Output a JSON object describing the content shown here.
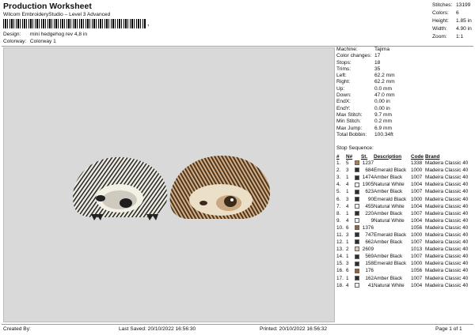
{
  "header": {
    "title": "Production Worksheet",
    "subtitle": "Wilcom EmbroideryStudio – Level 3 Advanced",
    "barcode_suffix": ",",
    "design_label": "Design:",
    "design_value": "mini hedgehog rev 4,8 in",
    "colorway_label": "Colorway:",
    "colorway_value": "Colorway 1"
  },
  "stats": [
    {
      "label": "Stitches:",
      "value": "13199"
    },
    {
      "label": "Colors:",
      "value": "6"
    },
    {
      "label": "Height:",
      "value": "1.85 in"
    },
    {
      "label": "Width:",
      "value": "4.90 in"
    },
    {
      "label": "Zoom:",
      "value": "1:1"
    }
  ],
  "info": [
    {
      "label": "Machine:",
      "value": "Tajima"
    },
    {
      "label": "Color changes:",
      "value": "17"
    },
    {
      "label": "Stops:",
      "value": "18"
    },
    {
      "label": "Trims:",
      "value": "35"
    },
    {
      "label": "Left:",
      "value": "62.2 mm"
    },
    {
      "label": "Right:",
      "value": "62.2 mm"
    },
    {
      "label": "Up:",
      "value": "0.0 mm"
    },
    {
      "label": "Down:",
      "value": "47.0 mm"
    },
    {
      "label": "EndX:",
      "value": "0.00 in"
    },
    {
      "label": "EndY:",
      "value": "0.00 in"
    },
    {
      "label": "Max Stitch:",
      "value": "9.7 mm"
    },
    {
      "label": "Min Stitch:",
      "value": "0.2 mm"
    },
    {
      "label": "Max Jump:",
      "value": "6.9 mm"
    },
    {
      "label": "Total Bobbin:",
      "value": "100.34ft"
    }
  ],
  "sequence": {
    "title": "Stop Sequence:",
    "headers": [
      "#",
      "N#",
      "",
      "St.",
      "Description",
      "Code",
      "Brand"
    ],
    "rows": [
      [
        "1.",
        "5",
        "#b08050",
        "1237",
        "",
        "1338",
        "Madeira Classic 40"
      ],
      [
        "2.",
        "3",
        "#2e2e2e",
        "684",
        "Emerald Black",
        "1000",
        "Madeira Classic 40"
      ],
      [
        "3.",
        "1",
        "#2e2e2e",
        "1474",
        "Amber Black",
        "1007",
        "Madeira Classic 40"
      ],
      [
        "4.",
        "4",
        "#f4f1e8",
        "1905",
        "Natural White",
        "1004",
        "Madeira Classic 40"
      ],
      [
        "5.",
        "1",
        "#2e2e2e",
        "623",
        "Amber Black",
        "1007",
        "Madeira Classic 40"
      ],
      [
        "6.",
        "3",
        "#2e2e2e",
        "90",
        "Emerald Black",
        "1000",
        "Madeira Classic 40"
      ],
      [
        "7.",
        "4",
        "#f4f1e8",
        "455",
        "Natural White",
        "1004",
        "Madeira Classic 40"
      ],
      [
        "8.",
        "1",
        "#2e2e2e",
        "220",
        "Amber Black",
        "1007",
        "Madeira Classic 40"
      ],
      [
        "9.",
        "4",
        "#f4f1e8",
        "9",
        "Natural White",
        "1004",
        "Madeira Classic 40"
      ],
      [
        "10.",
        "6",
        "#a0622d",
        "1376",
        "",
        "1056",
        "Madeira Classic 40"
      ],
      [
        "11.",
        "3",
        "#2e2e2e",
        "747",
        "Emerald Black",
        "1000",
        "Madeira Classic 40"
      ],
      [
        "12.",
        "1",
        "#2e2e2e",
        "662",
        "Amber Black",
        "1007",
        "Madeira Classic 40"
      ],
      [
        "13.",
        "2",
        "#e8c8b0",
        "2609",
        "",
        "1013",
        "Madeira Classic 40"
      ],
      [
        "14.",
        "1",
        "#2e2e2e",
        "569",
        "Amber Black",
        "1007",
        "Madeira Classic 40"
      ],
      [
        "15.",
        "3",
        "#2e2e2e",
        "158",
        "Emerald Black",
        "1000",
        "Madeira Classic 40"
      ],
      [
        "16.",
        "6",
        "#a0622d",
        "176",
        "",
        "1056",
        "Madeira Classic 40"
      ],
      [
        "17.",
        "1",
        "#2e2e2e",
        "162",
        "Amber Black",
        "1007",
        "Madeira Classic 40"
      ],
      [
        "18.",
        "4",
        "#f4f1e8",
        "41",
        "Natural White",
        "1004",
        "Madeira Classic 40"
      ]
    ]
  },
  "footer": {
    "created_by": "Created By:",
    "last_saved": "Last Saved: 20/10/2022 16:56:30",
    "printed": "Printed: 20/10/2022 16:56:32",
    "page": "Page 1 of 1"
  }
}
